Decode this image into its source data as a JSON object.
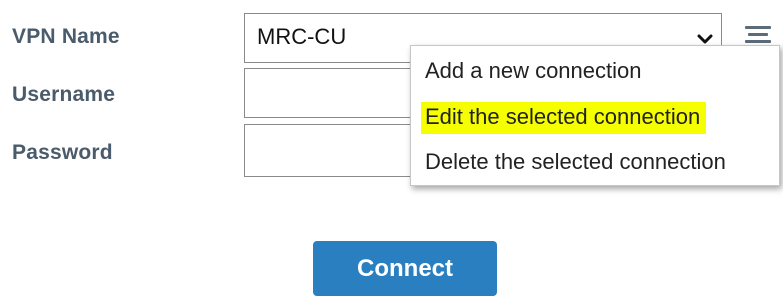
{
  "form": {
    "vpn_name_label": "VPN Name",
    "username_label": "Username",
    "password_label": "Password",
    "vpn_name_value": "MRC-CU",
    "username_value": "",
    "password_value": ""
  },
  "menu": {
    "icon": "hamburger-menu-icon",
    "items": [
      "Add a new connection",
      "Edit the selected connection",
      "Delete the selected connection"
    ],
    "highlighted_index": 1
  },
  "actions": {
    "connect_label": "Connect"
  },
  "colors": {
    "label": "#4a5b6b",
    "button": "#2a7fc1",
    "highlight": "#f6ff00"
  }
}
